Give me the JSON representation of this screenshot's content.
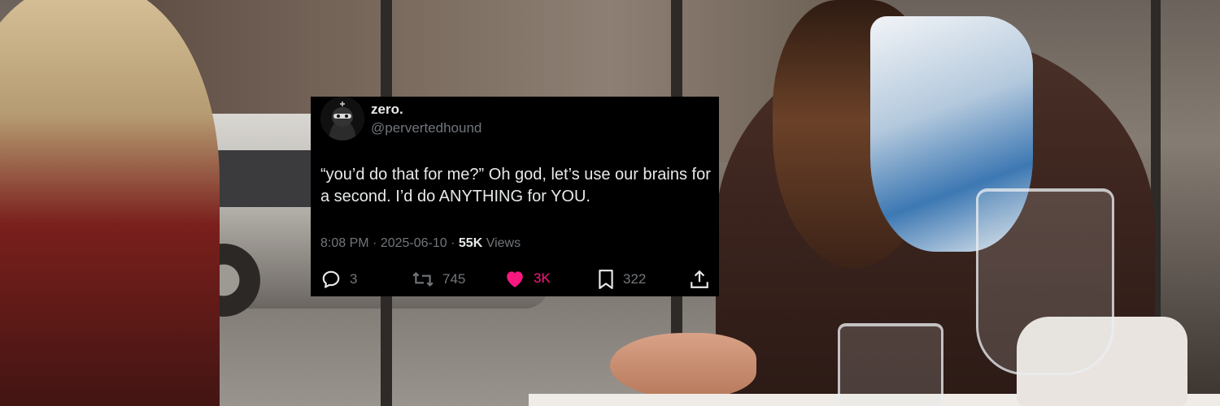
{
  "tweet": {
    "display_name": "zero.",
    "handle": "@pervertedhound",
    "text": "“you’d do that for me?” Oh god, let’s use our brains for a second. I’d do ANYTHING for YOU.",
    "time": "8:08 PM",
    "date": "2025-06-10",
    "views_count": "55K",
    "views_label": "Views",
    "separator": "·",
    "replies": "3",
    "reposts": "745",
    "likes": "3K",
    "bookmarks": "322",
    "liked": true
  },
  "icons": {
    "reply": "reply-icon",
    "repost": "repost-icon",
    "like": "heart-icon",
    "bookmark": "bookmark-icon",
    "share": "share-icon"
  },
  "colors": {
    "card_background": "#000000",
    "text_primary": "#e7e9ea",
    "text_secondary": "#71767b",
    "like_active": "#f91880"
  }
}
